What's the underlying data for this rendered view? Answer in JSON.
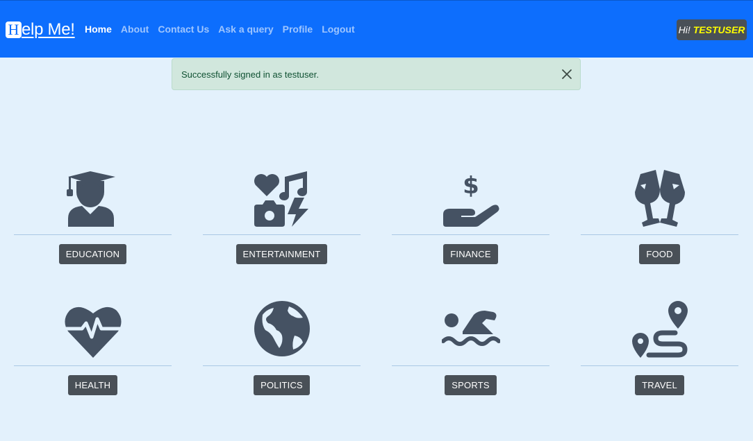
{
  "brand": {
    "h": "H",
    "rest": "elp Me!"
  },
  "nav": [
    {
      "label": "Home",
      "active": true
    },
    {
      "label": "About",
      "active": false
    },
    {
      "label": "Contact Us",
      "active": false
    },
    {
      "label": "Ask a query",
      "active": false
    },
    {
      "label": "Profile",
      "active": false
    },
    {
      "label": "Logout",
      "active": false
    }
  ],
  "user": {
    "greeting": "Hi!",
    "name": "TESTUSER"
  },
  "alert": {
    "message": "Successfully signed in as testuser."
  },
  "categories": [
    {
      "label": "EDUCATION",
      "icon": "graduate-icon"
    },
    {
      "label": "ENTERTAINMENT",
      "icon": "entertainment-icon"
    },
    {
      "label": "FINANCE",
      "icon": "hand-dollar-icon"
    },
    {
      "label": "FOOD",
      "icon": "wine-glasses-icon"
    },
    {
      "label": "HEALTH",
      "icon": "heart-pulse-icon"
    },
    {
      "label": "POLITICS",
      "icon": "globe-icon"
    },
    {
      "label": "SPORTS",
      "icon": "swimmer-icon"
    },
    {
      "label": "TRAVEL",
      "icon": "route-icon"
    }
  ],
  "colors": {
    "navbar": "#0d6efd",
    "page": "#e3f1fc",
    "badge": "#495057",
    "username": "#ffff00",
    "icon": "#455263"
  }
}
